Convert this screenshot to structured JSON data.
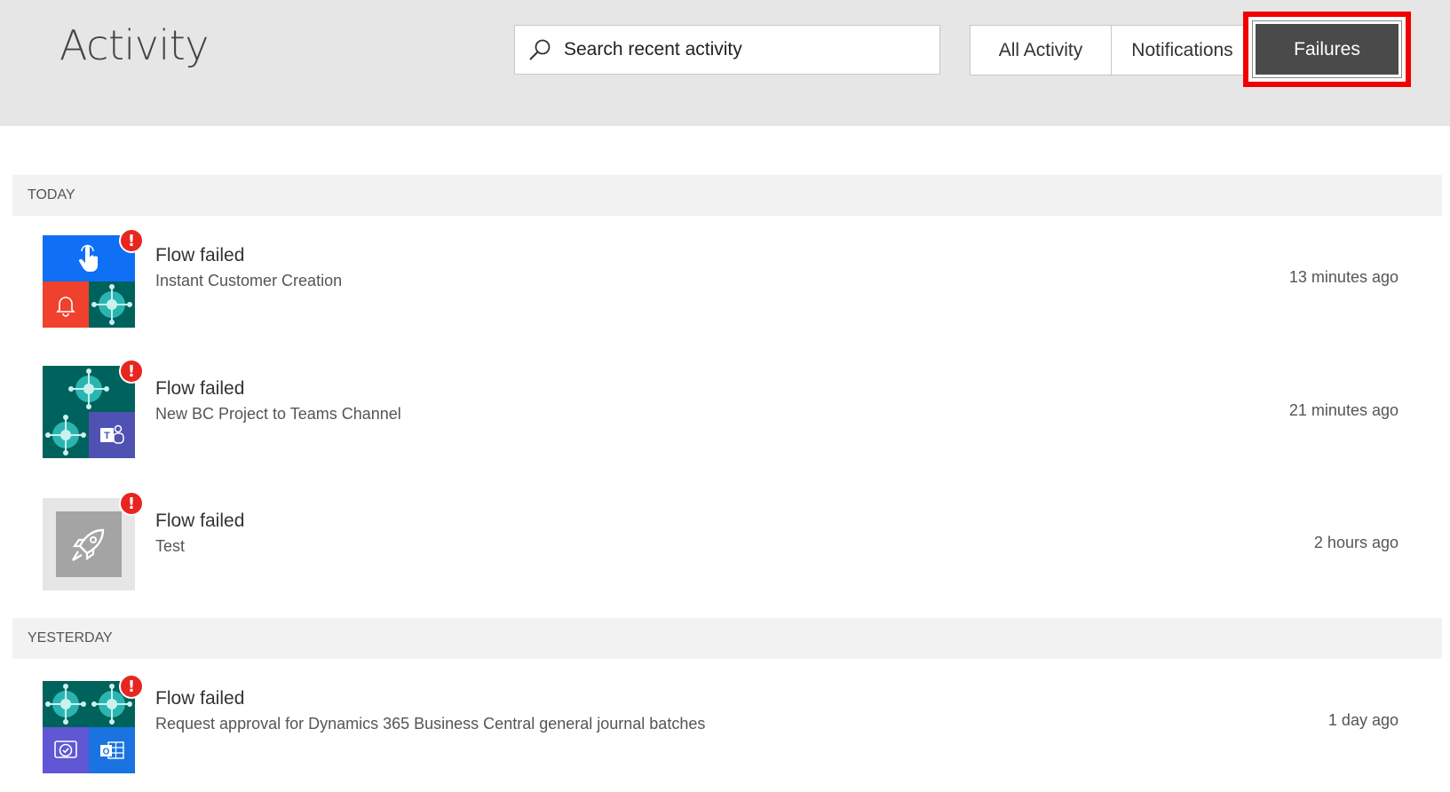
{
  "header": {
    "title": "Activity",
    "search_placeholder": "Search recent activity",
    "filters": {
      "all": "All Activity",
      "notifications": "Notifications",
      "failures": "Failures"
    },
    "highlight_color": "#f00000"
  },
  "sections": {
    "today": "TODAY",
    "yesterday": "YESTERDAY"
  },
  "items": [
    {
      "title": "Flow failed",
      "subtitle": "Instant Customer Creation",
      "time": "13 minutes ago",
      "icons": [
        "touch-icon",
        "bell-icon",
        "business-central-icon"
      ]
    },
    {
      "title": "Flow failed",
      "subtitle": "New BC Project to Teams Channel",
      "time": "21 minutes ago",
      "icons": [
        "business-central-icon",
        "business-central-icon",
        "teams-icon"
      ]
    },
    {
      "title": "Flow failed",
      "subtitle": "Test",
      "time": "2 hours ago",
      "icons": [
        "rocket-icon"
      ]
    },
    {
      "title": "Flow failed",
      "subtitle": "Request approval for Dynamics 365 Business Central general journal batches",
      "time": "1 day ago",
      "icons": [
        "business-central-icon",
        "business-central-icon",
        "approvals-icon",
        "outlook-icon"
      ]
    }
  ],
  "badge_symbol": "!",
  "colors": {
    "touch": "#0f6ff5",
    "bell": "#f0412c",
    "business_central": "#00625c",
    "teams": "#4f52b2",
    "approvals": "#5f57d4",
    "outlook": "#1a73e0",
    "rocket_bg": "#e6e6e6",
    "rocket_fg": "#a4a4a4",
    "badge": "#e8251f",
    "failures_btn": "#4a4a4a"
  }
}
